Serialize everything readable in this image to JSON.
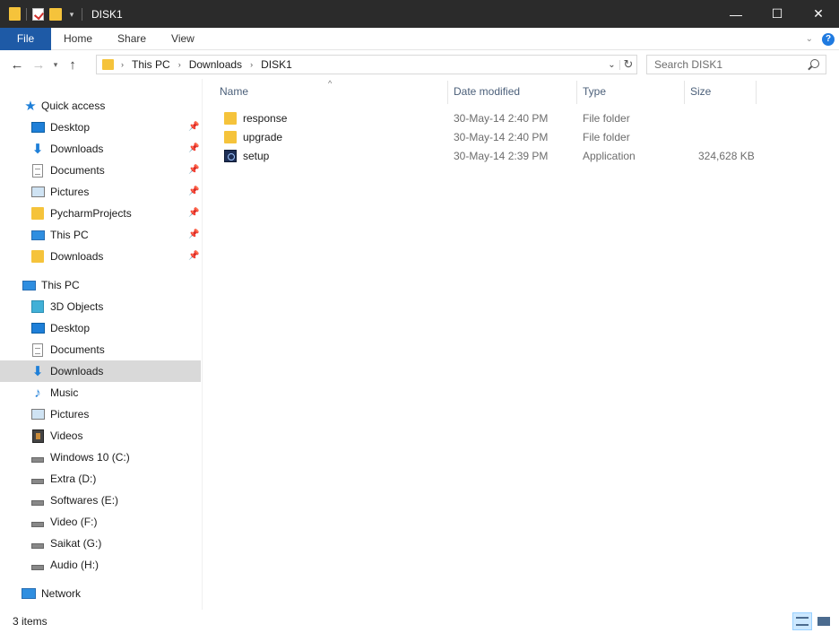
{
  "window": {
    "title": "DISK1",
    "minimize": "—",
    "maximize": "☐",
    "close": "✕"
  },
  "ribbon": {
    "tabs": [
      "File",
      "Home",
      "Share",
      "View"
    ],
    "help": "?"
  },
  "address": {
    "crumbs": [
      "This PC",
      "Downloads",
      "DISK1"
    ]
  },
  "search": {
    "placeholder": "Search DISK1"
  },
  "sidebar": {
    "quick_access_label": "Quick access",
    "quick_access": [
      {
        "label": "Desktop",
        "icon": "desktop-icon",
        "pinned": true
      },
      {
        "label": "Downloads",
        "icon": "downloads-icon",
        "pinned": true
      },
      {
        "label": "Documents",
        "icon": "documents-icon",
        "pinned": true
      },
      {
        "label": "Pictures",
        "icon": "pictures-icon",
        "pinned": true
      },
      {
        "label": "PycharmProjects",
        "icon": "folder-icon",
        "pinned": true
      },
      {
        "label": "This PC",
        "icon": "this-pc-icon",
        "pinned": true
      },
      {
        "label": "Downloads",
        "icon": "folder-icon",
        "pinned": true
      }
    ],
    "this_pc_label": "This PC",
    "this_pc": [
      {
        "label": "3D Objects",
        "icon": "3d-objects-icon"
      },
      {
        "label": "Desktop",
        "icon": "desktop-icon"
      },
      {
        "label": "Documents",
        "icon": "documents-icon"
      },
      {
        "label": "Downloads",
        "icon": "downloads-icon",
        "selected": true
      },
      {
        "label": "Music",
        "icon": "music-icon"
      },
      {
        "label": "Pictures",
        "icon": "pictures-icon"
      },
      {
        "label": "Videos",
        "icon": "videos-icon"
      },
      {
        "label": "Windows 10 (C:)",
        "icon": "drive-icon"
      },
      {
        "label": "Extra (D:)",
        "icon": "drive-icon"
      },
      {
        "label": "Softwares (E:)",
        "icon": "drive-icon"
      },
      {
        "label": "Video (F:)",
        "icon": "drive-icon"
      },
      {
        "label": "Saikat (G:)",
        "icon": "drive-icon"
      },
      {
        "label": "Audio (H:)",
        "icon": "drive-icon"
      }
    ],
    "network_label": "Network"
  },
  "files": {
    "columns": [
      "Name",
      "Date modified",
      "Type",
      "Size"
    ],
    "rows": [
      {
        "name": "response",
        "date": "30-May-14 2:40 PM",
        "type": "File folder",
        "size": "",
        "icon": "folder"
      },
      {
        "name": "upgrade",
        "date": "30-May-14 2:40 PM",
        "type": "File folder",
        "size": "",
        "icon": "folder"
      },
      {
        "name": "setup",
        "date": "30-May-14 2:39 PM",
        "type": "Application",
        "size": "324,628 KB",
        "icon": "app"
      }
    ]
  },
  "status": {
    "item_count": "3 items"
  },
  "colors": {
    "titlebar": "#2b2b2b",
    "file_tab": "#1e5aa6",
    "selected_nav": "#d9d9d9",
    "folder": "#f5c33b"
  }
}
